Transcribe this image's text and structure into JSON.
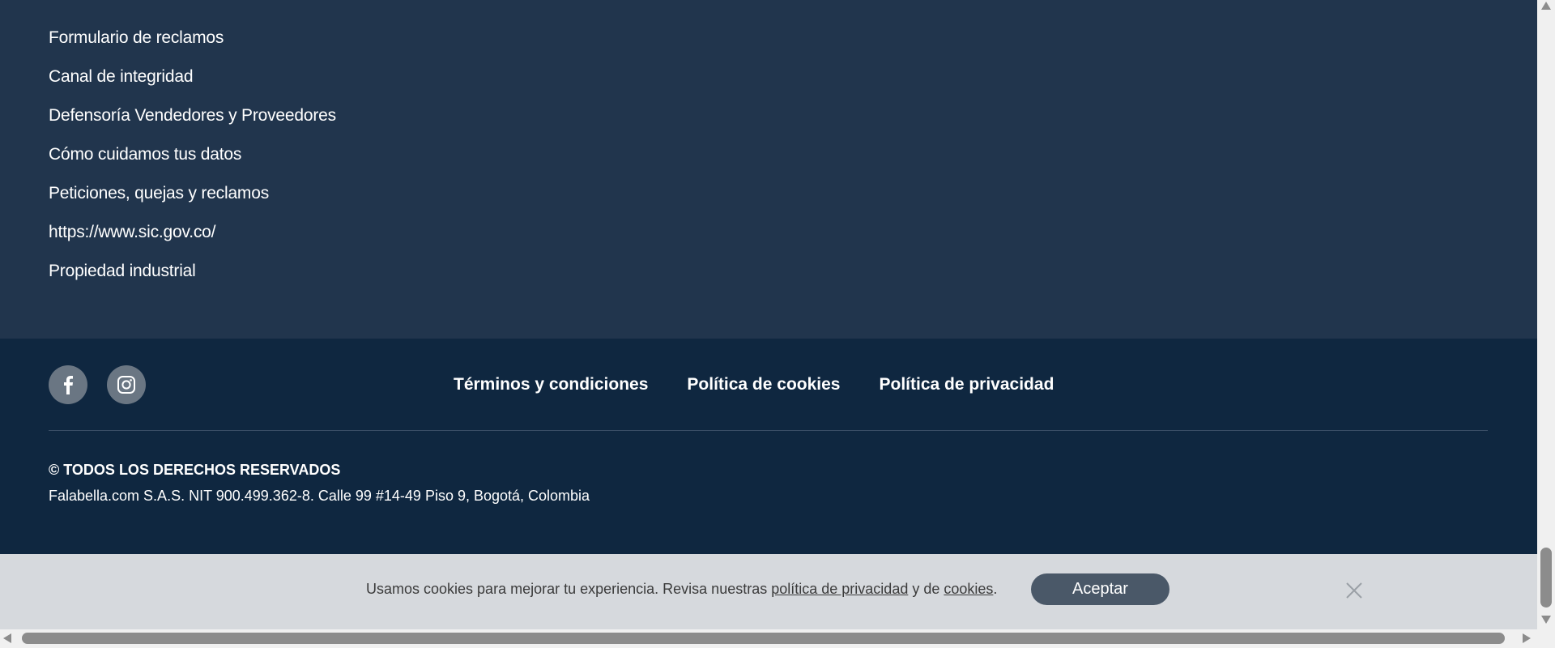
{
  "footer_links": [
    "Formulario de reclamos",
    "Canal de integridad",
    "Defensoría Vendedores y Proveedores",
    "Cómo cuidamos tus datos",
    "Peticiones, quejas y reclamos",
    "https://www.sic.gov.co/",
    "Propiedad industrial"
  ],
  "legal_links": {
    "terms": "Términos y condiciones",
    "cookies": "Política de cookies",
    "privacy": "Política de privacidad"
  },
  "social": [
    "facebook-icon",
    "instagram-icon"
  ],
  "copyright": {
    "title": "© TODOS LOS DERECHOS RESERVADOS",
    "address": "Falabella.com S.A.S. NIT 900.499.362-8. Calle 99 #14-49 Piso 9, Bogotá, Colombia"
  },
  "cookie_banner": {
    "text_before": "Usamos cookies para mejorar tu experiencia. Revisa nuestras ",
    "privacy_link": "política de privacidad",
    "text_middle": " y de ",
    "cookies_link": "cookies",
    "text_after": ".",
    "accept_label": "Aceptar"
  },
  "colors": {
    "links_bg": "#21354d",
    "footer_bg": "#0f2740",
    "banner_bg": "#d6d9dd",
    "accept_bg": "#4a5868"
  }
}
